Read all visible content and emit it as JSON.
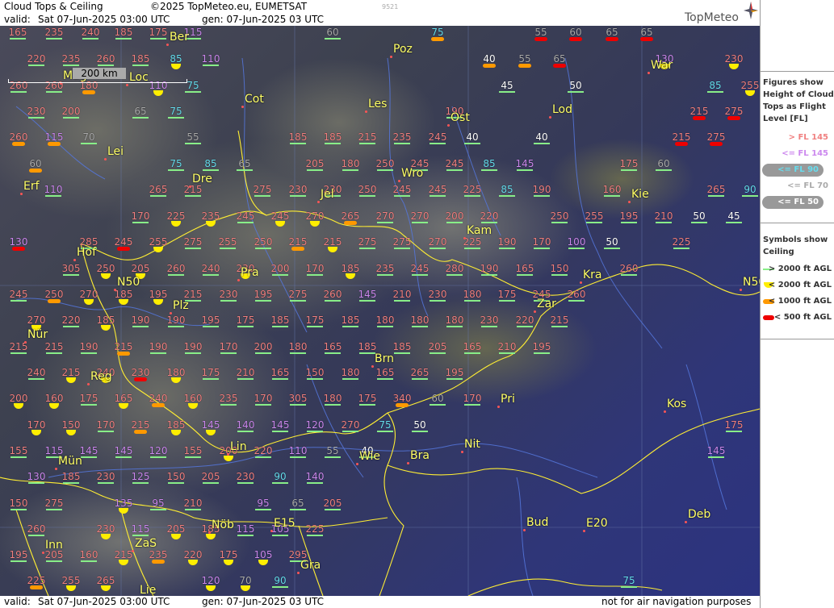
{
  "header": {
    "title": "Cloud Tops & Ceiling",
    "copyright": "©2025 TopMeteo.eu, EUMETSAT",
    "code": "9521",
    "valid_label": "valid:",
    "valid_value": "Sat   07-Jun-2025   03:00 UTC",
    "gen_value": "gen: 07-Jun-2025 03 UTC",
    "logo": "TopMeteo"
  },
  "footer": {
    "valid_label": "valid:",
    "valid_value": "Sat   07-Jun-2025   03:00 UTC",
    "gen_value": "gen: 07-Jun-2025 03 UTC",
    "disclaimer": "not for air navigation purposes"
  },
  "scale_label": "200 km",
  "legend": {
    "figures_title": [
      "Figures show",
      "Height of Cloud",
      "Tops as Flight",
      "Level  [FL]"
    ],
    "figures": [
      {
        "text": "> FL 145",
        "color": "#f08080"
      },
      {
        "text": "<= FL 145",
        "color": "#cc88ee"
      },
      {
        "text": "<= FL 90",
        "color": "#66ddee"
      },
      {
        "text": "<= FL 70",
        "color": "#aaaaaa"
      },
      {
        "text": "<= FL 50",
        "color": "#ffffff"
      }
    ],
    "symbols_title": [
      "Symbols show",
      "Ceiling"
    ],
    "symbols": [
      {
        "text": "> 2000 ft AGL",
        "color": "#88ee88",
        "shape": "line"
      },
      {
        "text": "< 2000 ft AGL",
        "color": "#ffee00",
        "shape": "half"
      },
      {
        "text": "< 1000 ft AGL",
        "color": "#ff9900",
        "shape": "pill"
      },
      {
        "text": "< 500 ft AGL",
        "color": "#ee0000",
        "shape": "pill"
      }
    ]
  },
  "colors": {
    "c_hi": "#f08080",
    "c_mid": "#cc88ee",
    "c_lo": "#66ddee",
    "c_vlo": "#aaaaaa",
    "c_min": "#ffffff",
    "sym_line": "#88ee88",
    "sym_half": "#ffee00",
    "sym_orange": "#ff9900",
    "sym_red": "#ee0000",
    "city": "#ffff66"
  },
  "cities": [
    "Ber",
    "Poz",
    "War",
    "Mag",
    "Loc",
    "Cot",
    "Les",
    "Lod",
    "Ost",
    "Lei",
    "Wro",
    "Dre",
    "Erf",
    "Jel",
    "Kie",
    "Kam",
    "Hof",
    "N50",
    "Pra",
    "Kra",
    "Plz",
    "Zar",
    "Nür",
    "Brn",
    "Reg",
    "Pri",
    "Kos",
    "Lin",
    "Nit",
    "Mün",
    "Wie",
    "Bra",
    "Deb",
    "Bud",
    "E20",
    "Nöb",
    "E15",
    "Inn",
    "ZaS",
    "Gra",
    "Lie",
    "N50"
  ],
  "observations": [
    "165",
    "235",
    "240",
    "185",
    "175",
    "115",
    "60",
    "75",
    "55",
    "60",
    "65",
    "65",
    "220",
    "235",
    "260",
    "185",
    "85",
    "110",
    "40",
    "55",
    "65",
    "130",
    "230",
    "260",
    "260",
    "180",
    "110",
    "75",
    "45",
    "50",
    "85",
    "255",
    "230",
    "200",
    "65",
    "75",
    "190",
    "215",
    "275",
    "260",
    "115",
    "70",
    "55",
    "185",
    "185",
    "215",
    "235",
    "245",
    "40",
    "40",
    "215",
    "275",
    "60",
    "75",
    "85",
    "65",
    "205",
    "180",
    "250",
    "245",
    "245",
    "85",
    "145",
    "175",
    "60",
    "110",
    "265",
    "215",
    "275",
    "230",
    "230",
    "250",
    "245",
    "245",
    "225",
    "85",
    "190",
    "160",
    "265",
    "90",
    "170",
    "225",
    "235",
    "245",
    "245",
    "270",
    "265",
    "270",
    "270",
    "200",
    "220",
    "250",
    "255",
    "195",
    "210",
    "50",
    "45",
    "130",
    "285",
    "245",
    "255",
    "275",
    "255",
    "250",
    "215",
    "215",
    "275",
    "275",
    "270",
    "225",
    "190",
    "170",
    "100",
    "50",
    "225",
    "305",
    "250",
    "205",
    "260",
    "240",
    "230",
    "200",
    "170",
    "185",
    "235",
    "245",
    "280",
    "190",
    "165",
    "150",
    "260",
    "245",
    "250",
    "270",
    "185",
    "195",
    "215",
    "230",
    "195",
    "275",
    "260",
    "145",
    "210",
    "230",
    "180",
    "175",
    "245",
    "260",
    "270",
    "220",
    "185",
    "190",
    "190",
    "195",
    "175",
    "185",
    "175",
    "185",
    "180",
    "180",
    "180",
    "230",
    "220",
    "215",
    "215",
    "215",
    "190",
    "215",
    "190",
    "190",
    "170",
    "200",
    "180",
    "165",
    "185",
    "185",
    "205",
    "165",
    "210",
    "195",
    "240",
    "215",
    "240",
    "230",
    "180",
    "175",
    "210",
    "165",
    "150",
    "180",
    "165",
    "265",
    "195",
    "200",
    "160",
    "175",
    "165",
    "240",
    "160",
    "235",
    "170",
    "305",
    "180",
    "175",
    "340",
    "60",
    "170",
    "170",
    "150",
    "170",
    "215",
    "185",
    "145",
    "140",
    "145",
    "120",
    "270",
    "75",
    "50",
    "175",
    "155",
    "115",
    "145",
    "145",
    "120",
    "155",
    "200",
    "220",
    "110",
    "55",
    "40",
    "145",
    "130",
    "185",
    "230",
    "125",
    "150",
    "205",
    "230",
    "90",
    "140",
    "150",
    "275",
    "135",
    "95",
    "210",
    "95",
    "65",
    "205",
    "260",
    "230",
    "115",
    "205",
    "185",
    "115",
    "105",
    "225",
    "195",
    "205",
    "160",
    "215",
    "235",
    "220",
    "175",
    "105",
    "295",
    "225",
    "255",
    "265",
    "120",
    "70",
    "90",
    "75"
  ]
}
